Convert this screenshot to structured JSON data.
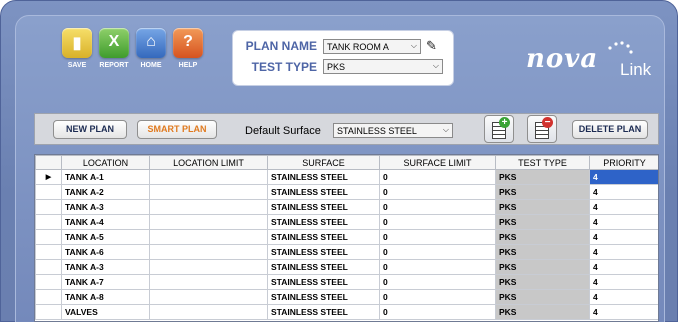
{
  "toolbar": {
    "items": [
      {
        "label": "SAVE",
        "icon": "save-icon"
      },
      {
        "label": "REPORT",
        "icon": "excel-report-icon"
      },
      {
        "label": "HOME",
        "icon": "home-icon"
      },
      {
        "label": "HELP",
        "icon": "help-icon"
      }
    ]
  },
  "plan": {
    "name_label": "PLAN NAME",
    "name_value": "TANK ROOM A",
    "type_label": "TEST TYPE",
    "type_value": "PKS"
  },
  "logo": {
    "nova": "nova",
    "link": "Link"
  },
  "actions": {
    "new_plan": "NEW PLAN",
    "smart_plan": "SMART PLAN",
    "default_surface_label": "Default Surface",
    "default_surface_value": "STAINLESS STEEL",
    "delete_plan": "DELETE PLAN"
  },
  "table": {
    "columns": [
      "LOCATION",
      "LOCATION LIMIT",
      "SURFACE",
      "SURFACE LIMIT",
      "TEST TYPE",
      "PRIORITY"
    ],
    "rows": [
      {
        "location": "TANK A-1",
        "location_limit": "",
        "surface": "STAINLESS STEEL",
        "surface_limit": "0",
        "test_type": "PKS",
        "priority": "4",
        "selected": true
      },
      {
        "location": "TANK A-2",
        "location_limit": "",
        "surface": "STAINLESS STEEL",
        "surface_limit": "0",
        "test_type": "PKS",
        "priority": "4"
      },
      {
        "location": "TANK A-3",
        "location_limit": "",
        "surface": "STAINLESS STEEL",
        "surface_limit": "0",
        "test_type": "PKS",
        "priority": "4"
      },
      {
        "location": "TANK A-4",
        "location_limit": "",
        "surface": "STAINLESS STEEL",
        "surface_limit": "0",
        "test_type": "PKS",
        "priority": "4"
      },
      {
        "location": "TANK A-5",
        "location_limit": "",
        "surface": "STAINLESS STEEL",
        "surface_limit": "0",
        "test_type": "PKS",
        "priority": "4"
      },
      {
        "location": "TANK A-6",
        "location_limit": "",
        "surface": "STAINLESS STEEL",
        "surface_limit": "0",
        "test_type": "PKS",
        "priority": "4"
      },
      {
        "location": "TANK A-3",
        "location_limit": "",
        "surface": "STAINLESS STEEL",
        "surface_limit": "0",
        "test_type": "PKS",
        "priority": "4"
      },
      {
        "location": "TANK A-7",
        "location_limit": "",
        "surface": "STAINLESS STEEL",
        "surface_limit": "0",
        "test_type": "PKS",
        "priority": "4"
      },
      {
        "location": "TANK A-8",
        "location_limit": "",
        "surface": "STAINLESS STEEL",
        "surface_limit": "0",
        "test_type": "PKS",
        "priority": "4"
      },
      {
        "location": "VALVES",
        "location_limit": "",
        "surface": "STAINLESS STEEL",
        "surface_limit": "0",
        "test_type": "PKS",
        "priority": "4"
      }
    ]
  },
  "colors": {
    "frame": "#6a80b1",
    "plan_label": "#4e65a6",
    "smart_plan": "#e07a1f",
    "selected_cell": "#2e63c8"
  }
}
